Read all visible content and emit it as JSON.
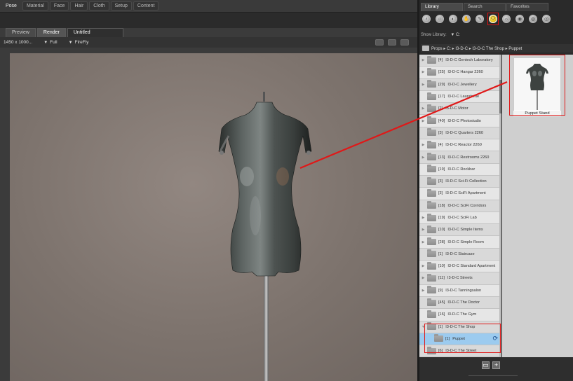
{
  "top_tabs": [
    "Pose",
    "Material",
    "Face",
    "Hair",
    "Cloth",
    "Setup",
    "Content"
  ],
  "viewport": {
    "tabs": [
      {
        "label": "Preview"
      },
      {
        "label": "Render"
      },
      {
        "label": "Untitled"
      }
    ],
    "toolbar": {
      "resolution": "1450 x 1000...",
      "quality": "Full",
      "renderer": "FireFly"
    }
  },
  "library": {
    "tabs": [
      "Library",
      "Search",
      "Favorites"
    ],
    "category_icons": [
      "figures-icon",
      "poses-icon",
      "expressions-icon",
      "hair-icon",
      "hands-icon",
      "props-icon",
      "lights-icon",
      "cameras-icon",
      "materials-icon",
      "scenes-icon"
    ],
    "active_category": "props-icon",
    "show_library_label": "Show Library:",
    "show_library_value": "C:",
    "breadcrumb": [
      "Props",
      "C:",
      "I3-D-C",
      "I3-O-C The Shop",
      "Puppet"
    ],
    "tree": [
      {
        "count": "[4]",
        "name": "I3-D-C Gentech Laboratory",
        "expand": true
      },
      {
        "count": "[25]",
        "name": "I3-D-C Hangar 2260",
        "expand": true
      },
      {
        "count": "[29]",
        "name": "I3-D-C Jewellery",
        "expand": true
      },
      {
        "count": "[17]",
        "name": "I3-D-C Laundrette",
        "expand": false
      },
      {
        "count": "[2]",
        "name": "I3-D-C Motor",
        "expand": true
      },
      {
        "count": "[40]",
        "name": "I3-D-C Photostudio",
        "expand": true
      },
      {
        "count": "[3]",
        "name": "I3-D-C Quarters 2260",
        "expand": false
      },
      {
        "count": "[4]",
        "name": "I3-D-C Reactor 2260",
        "expand": true
      },
      {
        "count": "[13]",
        "name": "I3-D-C Restrooms 2260",
        "expand": true
      },
      {
        "count": "[19]",
        "name": "I3-D-C Rockbar",
        "expand": false
      },
      {
        "count": "[3]",
        "name": "I3-D-C Sci-Fi Collection",
        "expand": false
      },
      {
        "count": "[3]",
        "name": "I3-D-C SciFi Apartment",
        "expand": false
      },
      {
        "count": "[18]",
        "name": "I3-D-C SciFi Corridors",
        "expand": false
      },
      {
        "count": "[19]",
        "name": "I3-D-C SciFi Lab",
        "expand": true
      },
      {
        "count": "[10]",
        "name": "I3-D-C Simple Items",
        "expand": true
      },
      {
        "count": "[28]",
        "name": "I3-D-C Simple Room",
        "expand": true
      },
      {
        "count": "[1]",
        "name": "I3-D-C Staircase",
        "expand": false
      },
      {
        "count": "[10]",
        "name": "I3-D-C Standard Apartment",
        "expand": true
      },
      {
        "count": "[11]",
        "name": "I3-D-C Streets",
        "expand": true
      },
      {
        "count": "[9]",
        "name": "I3-D-C Tanningsalon",
        "expand": true
      },
      {
        "count": "[45]",
        "name": "I3-D-C The Doctor",
        "expand": false
      },
      {
        "count": "[16]",
        "name": "I3-D-C The Gym",
        "expand": false
      },
      {
        "count": "[1]",
        "name": "I3-D-C The Shop",
        "expand": true,
        "open": true
      },
      {
        "count": "[1]",
        "name": "Puppet",
        "expand": false,
        "child": true,
        "selected": true
      },
      {
        "count": "[6]",
        "name": "I3-D-C The Street",
        "expand": false
      }
    ],
    "thumbnail": {
      "label": "Puppet Stand"
    }
  },
  "colors": {
    "highlight": "#e01818",
    "selected_row": "#9ccbef",
    "active_category": "#f2c400"
  }
}
